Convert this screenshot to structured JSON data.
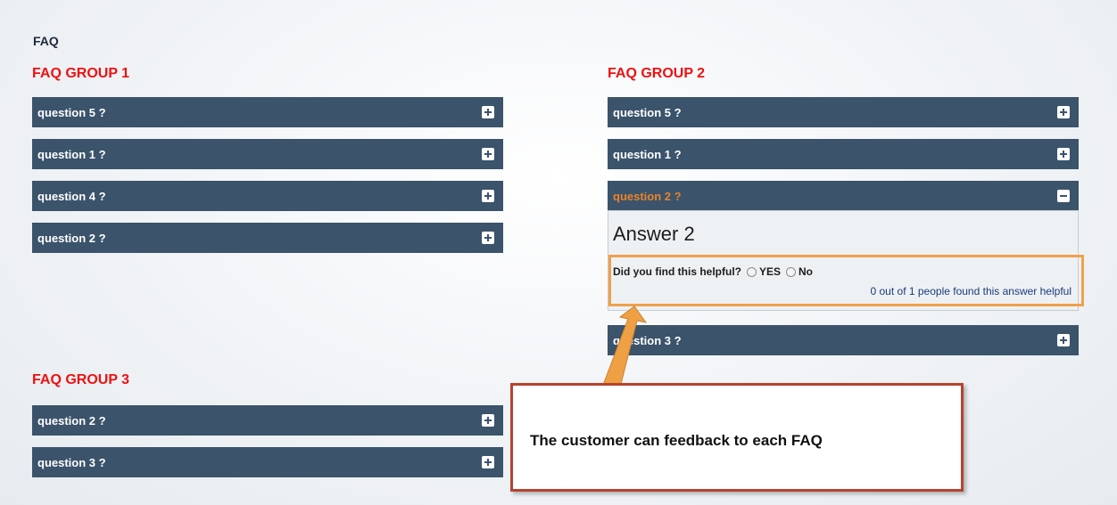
{
  "page": {
    "title": "FAQ"
  },
  "groups": [
    {
      "title": "FAQ GROUP 1",
      "questions": [
        {
          "label": "question 5 ?"
        },
        {
          "label": "question 1 ?"
        },
        {
          "label": "question 4 ?"
        },
        {
          "label": "question 2 ?"
        }
      ]
    },
    {
      "title": "FAQ GROUP 2",
      "questions": [
        {
          "label": "question 5 ?"
        },
        {
          "label": "question 1 ?"
        },
        {
          "label": "question 2 ?",
          "expanded": true
        },
        {
          "label": "question 3 ?"
        }
      ],
      "answer": {
        "text": "Answer 2",
        "feedback_prompt": "Did you find this helpful?",
        "yes_label": "YES",
        "no_label": "No",
        "helpful_count": "0 out of 1 people found this answer helpful"
      }
    },
    {
      "title": "FAQ GROUP 3",
      "questions": [
        {
          "label": "question 2 ?"
        },
        {
          "label": "question 3 ?"
        }
      ]
    }
  ],
  "callout": {
    "text": "The customer can feedback to each FAQ"
  },
  "icons": {
    "expand": "plus-icon",
    "collapse": "minus-icon"
  },
  "colors": {
    "accent_red": "#ee1111",
    "bar_bg": "#3b536b",
    "open_question": "#e8832a",
    "highlight": "#f0a04b",
    "callout_border": "#b5432f"
  }
}
